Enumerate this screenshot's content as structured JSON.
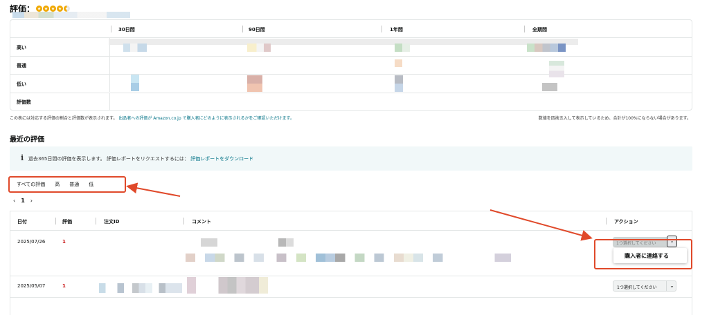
{
  "rating": {
    "title": "評価：",
    "star_rating": 4.5
  },
  "summary": {
    "columns": [
      "30日間",
      "90日間",
      "1年間",
      "全期間"
    ],
    "rows": [
      "高い",
      "普通",
      "低い",
      "評価数"
    ],
    "note_left_a": "この表には対応する評価の割合と評価数が表示されます。",
    "note_left_link": "出品者への評価が Amazon.co.jp で購入者にどのように表示されるかをご確認いただけます。",
    "note_right": "数値を四捨五入して表示しているため、合計が100%にならない場合があります。"
  },
  "recent": {
    "title": "最近の評価",
    "info_text": "過去365日間の評価を表示します。 評価レポートをリクエストするには：",
    "info_link": "評価レポートをダウンロード",
    "filters": [
      "すべての評価",
      "高",
      "普通",
      "低"
    ],
    "pager": {
      "prev": "‹",
      "page": "1",
      "next": "›"
    }
  },
  "table": {
    "headers": [
      "日付",
      "評価",
      "注文ID",
      "コメント",
      "アクション"
    ],
    "rows": [
      {
        "date": "2025/07/26",
        "rating": "1",
        "action": "1つ選択してください"
      },
      {
        "date": "2025/05/07",
        "rating": "1",
        "action": "1つ選択してください"
      }
    ],
    "menu_item": "購入者に連絡する",
    "chevron": "⌄"
  },
  "colors": {
    "accent": "#e0492a",
    "star": "#f0a800",
    "link": "#007185",
    "rating_low": "#c40000",
    "info_bg": "#f1f8f9"
  }
}
